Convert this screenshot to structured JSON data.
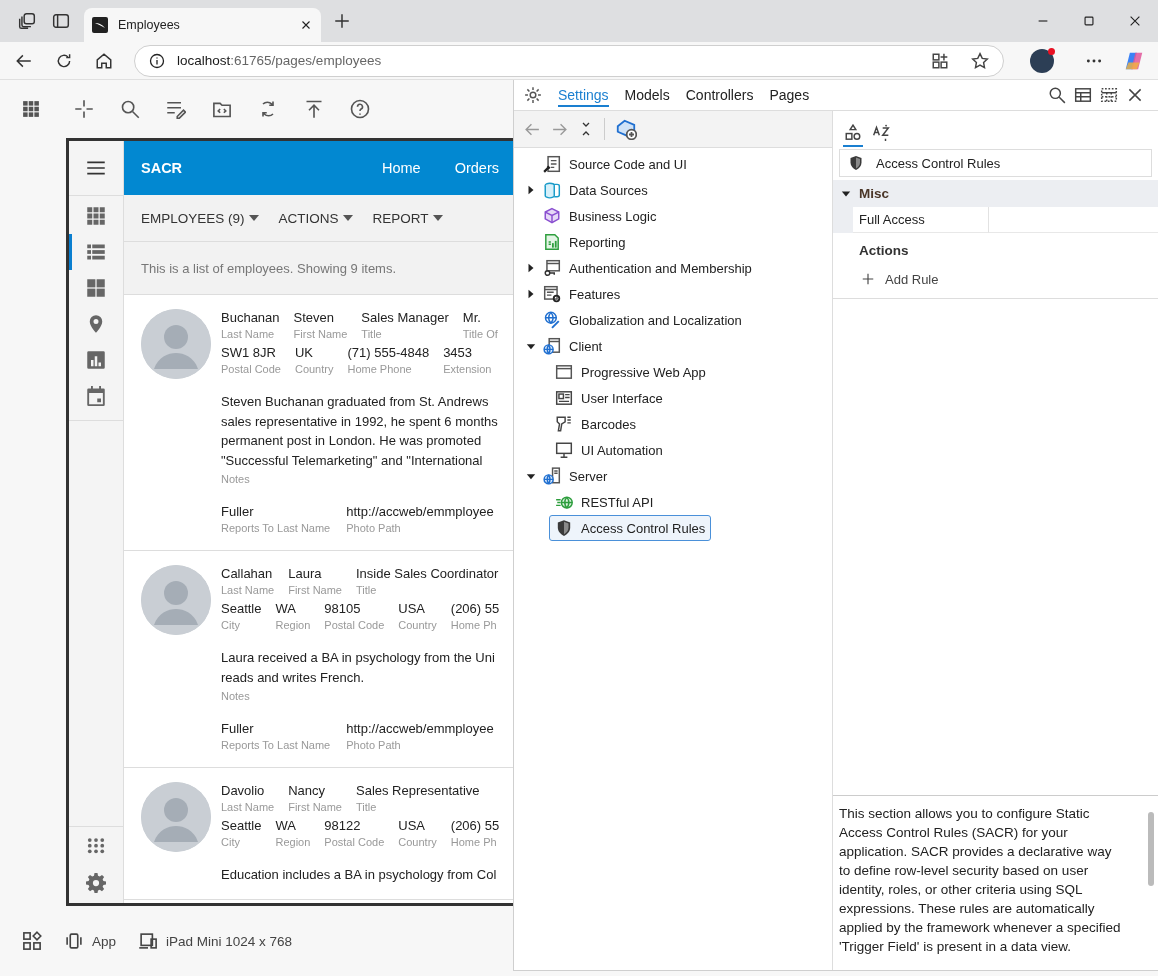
{
  "browser": {
    "tab_title": "Employees",
    "address_host": "localhost",
    "address_path": ":61765/pages/employees"
  },
  "app": {
    "brand": "SACR",
    "nav": [
      "Home",
      "Orders"
    ],
    "sidebar": [
      {
        "kind": "grid",
        "selected": false
      },
      {
        "kind": "list",
        "selected": true
      },
      {
        "kind": "tiles",
        "selected": false
      },
      {
        "kind": "pin",
        "selected": false
      },
      {
        "kind": "chart",
        "selected": false
      },
      {
        "kind": "calendar",
        "selected": false
      }
    ],
    "menus": [
      "EMPLOYEES (9)",
      "ACTIONS",
      "REPORT"
    ],
    "description": "This is a list of employees. Showing 9 items.",
    "cards": [
      {
        "rows": [
          [
            {
              "value": "Buchanan",
              "label": "Last Name"
            },
            {
              "value": "Steven",
              "label": "First Name"
            },
            {
              "value": "Sales Manager",
              "label": "Title"
            },
            {
              "value": "Mr.",
              "label": "Title Of"
            }
          ],
          [
            {
              "value": "SW1 8JR",
              "label": "Postal Code"
            },
            {
              "value": "UK",
              "label": "Country"
            },
            {
              "value": "(71) 555-4848",
              "label": "Home Phone"
            },
            {
              "value": "3453",
              "label": "Extension"
            }
          ]
        ],
        "notes": [
          "Steven Buchanan graduated from St. Andrews",
          "sales representative in 1992, he spent 6 months",
          "permanent post in London. He was promoted",
          "\"Successful Telemarketing\" and \"International"
        ],
        "notes_label": "Notes",
        "footer": [
          {
            "value": "Fuller",
            "label": "Reports To Last Name"
          },
          {
            "value": "http://accweb/emmployee",
            "label": "Photo Path"
          }
        ]
      },
      {
        "rows": [
          [
            {
              "value": "Callahan",
              "label": "Last Name"
            },
            {
              "value": "Laura",
              "label": "First Name"
            },
            {
              "value": "Inside Sales Coordinator",
              "label": "Title"
            }
          ],
          [
            {
              "value": "Seattle",
              "label": "City"
            },
            {
              "value": "WA",
              "label": "Region"
            },
            {
              "value": "98105",
              "label": "Postal Code"
            },
            {
              "value": "USA",
              "label": "Country"
            },
            {
              "value": "(206) 55",
              "label": "Home Ph"
            }
          ]
        ],
        "notes": [
          "Laura received a BA in psychology from the Uni",
          "reads and writes French."
        ],
        "notes_label": "Notes",
        "footer": [
          {
            "value": "Fuller",
            "label": "Reports To Last Name"
          },
          {
            "value": "http://accweb/emmployee",
            "label": "Photo Path"
          }
        ]
      },
      {
        "rows": [
          [
            {
              "value": "Davolio",
              "label": "Last Name"
            },
            {
              "value": "Nancy",
              "label": "First Name"
            },
            {
              "value": "Sales Representative",
              "label": "Title"
            }
          ],
          [
            {
              "value": "Seattle",
              "label": "City"
            },
            {
              "value": "WA",
              "label": "Region"
            },
            {
              "value": "98122",
              "label": "Postal Code"
            },
            {
              "value": "USA",
              "label": "Country"
            },
            {
              "value": "(206) 55",
              "label": "Home Ph"
            }
          ]
        ],
        "notes": [
          "Education includes a BA in psychology from Col"
        ]
      }
    ]
  },
  "status": {
    "app": "App",
    "device": "iPad Mini 1024 x 768"
  },
  "panel": {
    "tabs": [
      {
        "label": "Settings",
        "selected": true
      },
      {
        "label": "Models",
        "selected": false
      },
      {
        "label": "Controllers",
        "selected": false
      },
      {
        "label": "Pages",
        "selected": false
      }
    ],
    "tree": [
      {
        "label": "Source Code and UI",
        "kind": "source",
        "selected": false
      },
      {
        "label": "Data Sources",
        "kind": "database",
        "expanded": false,
        "selected": false
      },
      {
        "label": "Business Logic",
        "kind": "logic",
        "selected": false
      },
      {
        "label": "Reporting",
        "kind": "report",
        "selected": false
      },
      {
        "label": "Authentication and Membership",
        "kind": "auth",
        "expanded": false,
        "selected": false
      },
      {
        "label": "Features",
        "kind": "features",
        "expanded": false,
        "selected": false
      },
      {
        "label": "Globalization and Localization",
        "kind": "globe",
        "selected": false
      },
      {
        "label": "Client",
        "kind": "client",
        "expanded": true,
        "selected": false,
        "children": [
          {
            "label": "Progressive Web App",
            "kind": "pwa",
            "selected": false
          },
          {
            "label": "User Interface",
            "kind": "ui",
            "selected": false
          },
          {
            "label": "Barcodes",
            "kind": "barcode",
            "selected": false
          },
          {
            "label": "UI Automation",
            "kind": "monitor",
            "selected": false
          }
        ]
      },
      {
        "label": "Server",
        "kind": "server",
        "expanded": true,
        "selected": false,
        "children": [
          {
            "label": "RESTful API",
            "kind": "api",
            "selected": false
          },
          {
            "label": "Access Control Rules",
            "kind": "shield",
            "selected": true
          }
        ]
      }
    ],
    "views": [
      {
        "kind": "categorized",
        "selected": true
      },
      {
        "kind": "alphabetical",
        "selected": false
      }
    ],
    "object": "Access Control Rules",
    "category": {
      "name": "Misc",
      "expanded": true,
      "props": [
        {
          "name": "Full Access"
        }
      ]
    },
    "actions_title": "Actions",
    "actions": [
      "Add Rule"
    ],
    "description": "This section allows you to configure Static Access Control Rules (SACR) for your application. SACR provides a declarative way to define row-level security based on user identity, roles, or other criteria using SQL expressions. These rules are automatically applied by the framework whenever a specified 'Trigger Field' is present in a data view."
  }
}
